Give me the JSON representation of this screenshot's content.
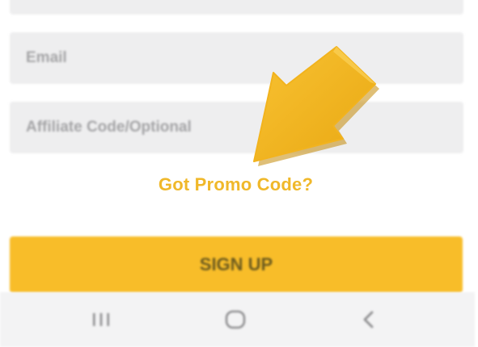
{
  "form": {
    "email_placeholder": "Email",
    "affiliate_placeholder": "Affiliate Code/Optional",
    "promo_link": "Got Promo Code?",
    "signup_label": "SIGN UP"
  },
  "navigation_bar": {
    "recents_icon": "recents-icon",
    "home_icon": "home-icon",
    "back_icon": "back-icon"
  },
  "annotation": {
    "arrow_icon": "pointer-arrow-icon",
    "arrow_color": "#f5b922"
  },
  "colors": {
    "accent": "#f8bd29",
    "promo_text": "#f0b82a",
    "field_bg": "#eeeeef"
  }
}
